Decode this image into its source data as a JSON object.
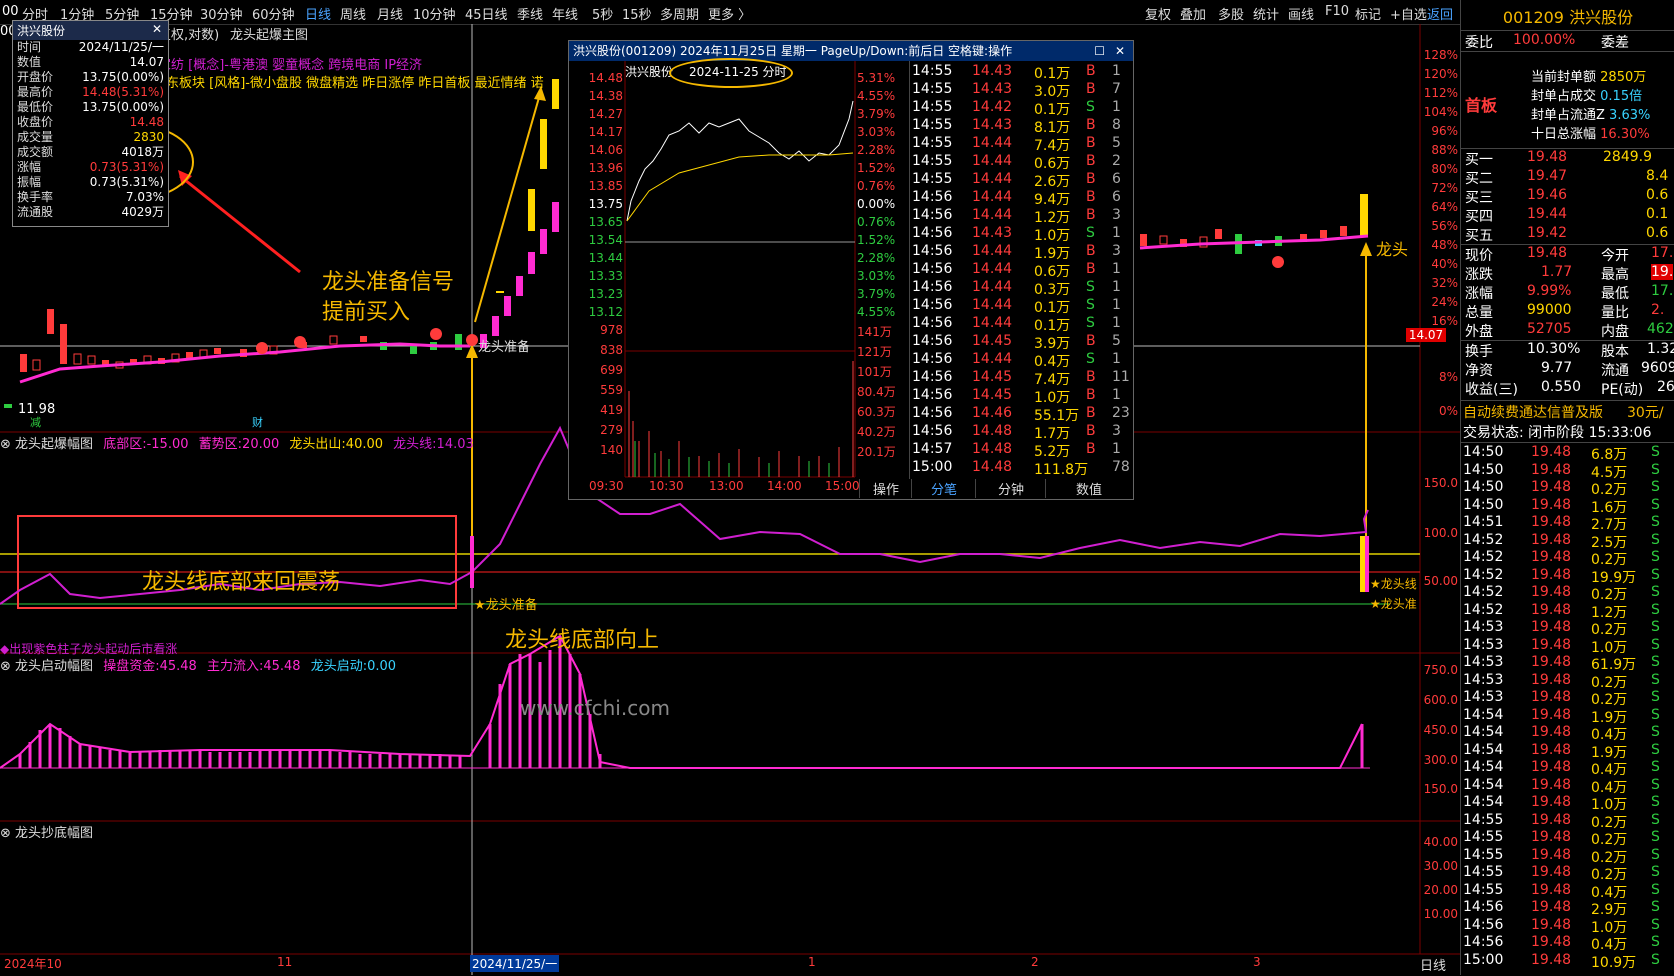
{
  "toolbar": {
    "items": [
      "分时",
      "1分钟",
      "5分钟",
      "15分钟",
      "30分钟",
      "60分钟",
      "日线",
      "周线",
      "月线",
      "10分钟",
      "45日线",
      "季线",
      "年线",
      "5秒",
      "15秒",
      "多周期",
      "更多 〉"
    ],
    "right_items": [
      "复权",
      "叠加",
      "多股",
      "统计",
      "画线",
      "F10",
      "标记",
      "+自选",
      "返回"
    ]
  },
  "info_box": {
    "title": "洪兴股份",
    "rows": [
      {
        "k": "时间",
        "v": "2024/11/25/一"
      },
      {
        "k": "数值",
        "v": "14.07"
      },
      {
        "k": "开盘价",
        "v": "13.75(0.00%)"
      },
      {
        "k": "最高价",
        "v": "14.48(5.31%)"
      },
      {
        "k": "最低价",
        "v": "13.75(0.00%)"
      },
      {
        "k": "收盘价",
        "v": "14.48"
      },
      {
        "k": "成交量",
        "v": "2830"
      },
      {
        "k": "成交额",
        "v": "4018万"
      },
      {
        "k": "涨幅",
        "v": "0.73(5.31%)"
      },
      {
        "k": "振幅",
        "v": "0.73(5.31%)"
      },
      {
        "k": "换手率",
        "v": "7.03%"
      },
      {
        "k": "流通股",
        "v": "4029万"
      }
    ]
  },
  "main_chart": {
    "title_fq": "复权,对数)",
    "title_main": "龙头起爆主图",
    "concepts_line1": "家纺 [概念]-粤港澳 婴童概念 跨境电商 IP经济",
    "concepts_line2": "东板块 [风格]-微小盘股 微盘精选 昨日涨停 昨日首板 最近情绪 诺",
    "annot_ready_signal_1": "龙头准备信号",
    "annot_ready_signal_2": "提前买入",
    "label_ready": "龙头准备",
    "low_label": "11.98",
    "marker_cai": "财",
    "marker_jian": "减",
    "right_label": "龙头",
    "price_tag": "14.07",
    "right_axis": [
      "128%",
      "120%",
      "112%",
      "104%",
      "96%",
      "88%",
      "80%",
      "72%",
      "64%",
      "56%",
      "48%",
      "40%",
      "32%",
      "24%",
      "16%",
      "8%",
      "0%"
    ]
  },
  "ind1": {
    "name": "龙头起爆幅图",
    "f1_label": "底部区:",
    "f1_val": "-15.00",
    "f2_label": "蓄势区:",
    "f2_val": "20.00",
    "f3_label": "龙头出山:",
    "f3_val": "40.00",
    "f4_label": "龙头线:",
    "f4_val": "14.03",
    "box_text": "龙头线底部来回震荡",
    "up_text": "龙头线底部向上",
    "ready_text": "★龙头准备",
    "bottom_note": "◆出现紫色柱子龙头起动后市看涨",
    "right_labels": [
      "★龙头线",
      "★龙头准"
    ],
    "axis": [
      "150.0",
      "100.0",
      "50.00"
    ]
  },
  "ind2": {
    "name": "龙头启动幅图",
    "f1_label": "操盘资金:",
    "f1_val": "45.48",
    "f2_label": "主力流入:",
    "f2_val": "45.48",
    "f3_label": "龙头启动:",
    "f3_val": "0.00",
    "watermark": "www.cfchi.com",
    "axis": [
      "750.0",
      "600.0",
      "450.0",
      "300.0",
      "150.0"
    ]
  },
  "ind3": {
    "name": "龙头抄底幅图",
    "axis": [
      "40.00",
      "30.00",
      "20.00",
      "10.00"
    ]
  },
  "date_axis": {
    "labels": [
      "2024年10",
      "11",
      "2024/11/25/一",
      "1",
      "2",
      "3"
    ],
    "period": "日线"
  },
  "popup": {
    "title": "洪兴股份(001209) 2024年11月25日 星期一 PageUp/Down:前后日 空格键:操作",
    "inner_name": "洪兴股份",
    "inner_date": "2024-11-25 分时",
    "left_axis": [
      "14.48",
      "14.38",
      "14.27",
      "14.17",
      "14.06",
      "13.96",
      "13.85",
      "13.75",
      "13.65",
      "13.54",
      "13.44",
      "13.33",
      "13.23",
      "13.12",
      "978",
      "838",
      "699",
      "559",
      "419",
      "279",
      "140"
    ],
    "right_axis": [
      "5.31%",
      "4.55%",
      "3.79%",
      "3.03%",
      "2.28%",
      "1.52%",
      "0.76%",
      "0.00%",
      "0.76%",
      "1.52%",
      "2.28%",
      "3.03%",
      "3.79%",
      "4.55%",
      "141万",
      "121万",
      "101万",
      "80.4万",
      "60.3万",
      "40.2万",
      "20.1万"
    ],
    "time_axis": [
      "09:30",
      "10:30",
      "13:00",
      "14:00",
      "15:00"
    ],
    "tabs": [
      "操作",
      "分笔",
      "分钟",
      "数值"
    ],
    "ticks": [
      {
        "t": "14:55",
        "p": "14.43",
        "v": "0.1万",
        "d": "B",
        "n": "1"
      },
      {
        "t": "14:55",
        "p": "14.43",
        "v": "3.0万",
        "d": "B",
        "n": "7"
      },
      {
        "t": "14:55",
        "p": "14.42",
        "v": "0.1万",
        "d": "S",
        "n": "1"
      },
      {
        "t": "14:55",
        "p": "14.43",
        "v": "8.1万",
        "d": "B",
        "n": "8"
      },
      {
        "t": "14:55",
        "p": "14.44",
        "v": "7.4万",
        "d": "B",
        "n": "5"
      },
      {
        "t": "14:55",
        "p": "14.44",
        "v": "0.6万",
        "d": "B",
        "n": "2"
      },
      {
        "t": "14:55",
        "p": "14.44",
        "v": "2.6万",
        "d": "B",
        "n": "6"
      },
      {
        "t": "14:56",
        "p": "14.44",
        "v": "9.4万",
        "d": "B",
        "n": "6"
      },
      {
        "t": "14:56",
        "p": "14.44",
        "v": "1.2万",
        "d": "B",
        "n": "3"
      },
      {
        "t": "14:56",
        "p": "14.43",
        "v": "1.0万",
        "d": "S",
        "n": "1"
      },
      {
        "t": "14:56",
        "p": "14.44",
        "v": "1.9万",
        "d": "B",
        "n": "3"
      },
      {
        "t": "14:56",
        "p": "14.44",
        "v": "0.6万",
        "d": "B",
        "n": "1"
      },
      {
        "t": "14:56",
        "p": "14.44",
        "v": "0.3万",
        "d": "S",
        "n": "1"
      },
      {
        "t": "14:56",
        "p": "14.44",
        "v": "0.1万",
        "d": "S",
        "n": "1"
      },
      {
        "t": "14:56",
        "p": "14.44",
        "v": "0.1万",
        "d": "S",
        "n": "1"
      },
      {
        "t": "14:56",
        "p": "14.45",
        "v": "3.9万",
        "d": "B",
        "n": "5"
      },
      {
        "t": "14:56",
        "p": "14.44",
        "v": "0.4万",
        "d": "S",
        "n": "1"
      },
      {
        "t": "14:56",
        "p": "14.45",
        "v": "7.4万",
        "d": "B",
        "n": "11"
      },
      {
        "t": "14:56",
        "p": "14.45",
        "v": "1.0万",
        "d": "B",
        "n": "1"
      },
      {
        "t": "14:56",
        "p": "14.46",
        "v": "55.1万",
        "d": "B",
        "n": "23"
      },
      {
        "t": "14:56",
        "p": "14.48",
        "v": "1.7万",
        "d": "B",
        "n": "3"
      },
      {
        "t": "14:57",
        "p": "14.48",
        "v": "5.2万",
        "d": "B",
        "n": "1"
      },
      {
        "t": "15:00",
        "p": "14.48",
        "v": "111.8万",
        "d": "",
        "n": "78"
      }
    ]
  },
  "right_panel": {
    "stock": "001209 洪兴股份",
    "wei_bi_label": "委比",
    "wei_bi": "100.00%",
    "wei_cha_label": "委差",
    "shouban": "首板",
    "seal": [
      {
        "k": "当前封单额",
        "v": "2850万"
      },
      {
        "k": "封单占成交",
        "v": "0.15倍"
      },
      {
        "k": "封单占流通Z",
        "v": "3.63%"
      },
      {
        "k": "十日总涨幅",
        "v": "16.30%"
      }
    ],
    "bids": [
      {
        "k": "买一",
        "p": "19.48",
        "v": "2849.9"
      },
      {
        "k": "买二",
        "p": "19.47",
        "v": "8.4"
      },
      {
        "k": "买三",
        "p": "19.46",
        "v": "0.6"
      },
      {
        "k": "买四",
        "p": "19.44",
        "v": "0.1"
      },
      {
        "k": "买五",
        "p": "19.42",
        "v": "0.6"
      }
    ],
    "quote": [
      {
        "k1": "现价",
        "v1": "19.48",
        "k2": "今开",
        "v2": "17."
      },
      {
        "k1": "涨跌",
        "v1": "1.77",
        "k2": "最高",
        "v2": "19."
      },
      {
        "k1": "涨幅",
        "v1": "9.99%",
        "k2": "最低",
        "v2": "17."
      },
      {
        "k1": "总量",
        "v1": "99000",
        "k2": "量比",
        "v2": "2."
      },
      {
        "k1": "外盘",
        "v1": "52705",
        "k2": "内盘",
        "v2": "462"
      }
    ],
    "stats": [
      {
        "k1": "换手",
        "v1": "10.30%",
        "k2": "股本",
        "v2": "1.32"
      },
      {
        "k1": "净资",
        "v1": "9.77",
        "k2": "流通",
        "v2": "9609"
      },
      {
        "k1": "收益(三)",
        "v1": "0.550",
        "k2": "PE(动)",
        "v2": "26"
      }
    ],
    "ad_text": "自动续费通达信普及版",
    "ad_price": "30元/",
    "status": "交易状态: 闭市阶段 15:33:06",
    "ticks": [
      {
        "t": "14:50",
        "p": "19.48",
        "v": "6.8万",
        "d": "S"
      },
      {
        "t": "14:50",
        "p": "19.48",
        "v": "4.5万",
        "d": "S"
      },
      {
        "t": "14:50",
        "p": "19.48",
        "v": "0.2万",
        "d": "S"
      },
      {
        "t": "14:50",
        "p": "19.48",
        "v": "1.6万",
        "d": "S"
      },
      {
        "t": "14:51",
        "p": "19.48",
        "v": "2.7万",
        "d": "S"
      },
      {
        "t": "14:52",
        "p": "19.48",
        "v": "2.5万",
        "d": "S"
      },
      {
        "t": "14:52",
        "p": "19.48",
        "v": "0.2万",
        "d": "S"
      },
      {
        "t": "14:52",
        "p": "19.48",
        "v": "19.9万",
        "d": "S"
      },
      {
        "t": "14:52",
        "p": "19.48",
        "v": "0.2万",
        "d": "S"
      },
      {
        "t": "14:52",
        "p": "19.48",
        "v": "1.2万",
        "d": "S"
      },
      {
        "t": "14:53",
        "p": "19.48",
        "v": "0.2万",
        "d": "S"
      },
      {
        "t": "14:53",
        "p": "19.48",
        "v": "1.0万",
        "d": "S"
      },
      {
        "t": "14:53",
        "p": "19.48",
        "v": "61.9万",
        "d": "S"
      },
      {
        "t": "14:53",
        "p": "19.48",
        "v": "0.2万",
        "d": "S"
      },
      {
        "t": "14:53",
        "p": "19.48",
        "v": "0.2万",
        "d": "S"
      },
      {
        "t": "14:54",
        "p": "19.48",
        "v": "1.9万",
        "d": "S"
      },
      {
        "t": "14:54",
        "p": "19.48",
        "v": "0.4万",
        "d": "S"
      },
      {
        "t": "14:54",
        "p": "19.48",
        "v": "1.9万",
        "d": "S"
      },
      {
        "t": "14:54",
        "p": "19.48",
        "v": "0.4万",
        "d": "S"
      },
      {
        "t": "14:54",
        "p": "19.48",
        "v": "0.4万",
        "d": "S"
      },
      {
        "t": "14:54",
        "p": "19.48",
        "v": "1.0万",
        "d": "S"
      },
      {
        "t": "14:55",
        "p": "19.48",
        "v": "0.2万",
        "d": "S"
      },
      {
        "t": "14:55",
        "p": "19.48",
        "v": "0.2万",
        "d": "S"
      },
      {
        "t": "14:55",
        "p": "19.48",
        "v": "0.2万",
        "d": "S"
      },
      {
        "t": "14:55",
        "p": "19.48",
        "v": "0.2万",
        "d": "S"
      },
      {
        "t": "14:55",
        "p": "19.48",
        "v": "0.4万",
        "d": "S"
      },
      {
        "t": "14:56",
        "p": "19.48",
        "v": "2.9万",
        "d": "S"
      },
      {
        "t": "14:56",
        "p": "19.48",
        "v": "1.0万",
        "d": "S"
      },
      {
        "t": "14:56",
        "p": "19.48",
        "v": "0.4万",
        "d": "S"
      },
      {
        "t": "15:00",
        "p": "19.48",
        "v": "10.9万",
        "d": "S"
      }
    ]
  }
}
